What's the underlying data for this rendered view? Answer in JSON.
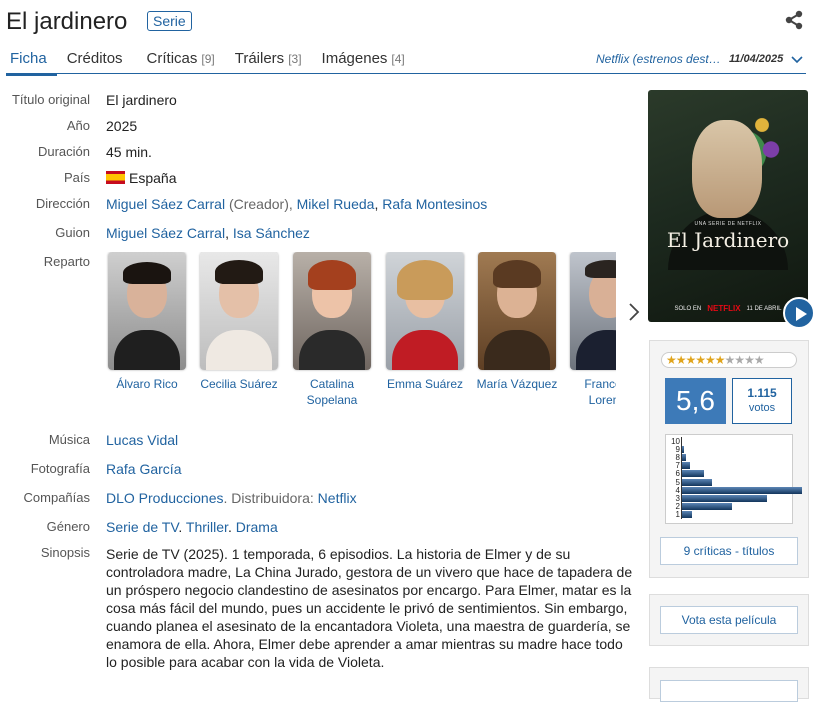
{
  "header": {
    "title": "El jardinero",
    "type_badge": "Serie"
  },
  "tabs": [
    {
      "label": "Ficha",
      "count": ""
    },
    {
      "label": "Créditos",
      "count": ""
    },
    {
      "label": "Críticas",
      "count": "[9]"
    },
    {
      "label": "Tráilers",
      "count": "[3]"
    },
    {
      "label": "Imágenes",
      "count": "[4]"
    }
  ],
  "release": {
    "platform": "Netflix (estrenos destacados)",
    "date": "11/04/2025"
  },
  "info": {
    "original_title_label": "Título original",
    "original_title": "El jardinero",
    "year_label": "Año",
    "year": "2025",
    "duration_label": "Duración",
    "duration": "45 min.",
    "country_label": "País",
    "country": "España",
    "direction_label": "Dirección",
    "director_1": "Miguel Sáez Carral",
    "director_1_role": " (Creador), ",
    "director_2": "Mikel Rueda",
    "director_sep": ", ",
    "director_3": "Rafa Montesinos",
    "script_label": "Guion",
    "script_1": "Miguel Sáez Carral",
    "script_sep": ", ",
    "script_2": "Isa Sánchez",
    "cast_label": "Reparto",
    "music_label": "Música",
    "music": "Lucas Vidal",
    "photo_label": "Fotografía",
    "photo": "Rafa García",
    "companies_label": "Compañías",
    "company_1": "DLO Producciones",
    "distributor_text": ". Distribuidora: ",
    "distributor": "Netflix",
    "genre_label": "Género",
    "genre_1": "Serie de TV",
    "genre_2": "Thriller",
    "genre_3": "Drama",
    "synopsis_label": "Sinopsis",
    "synopsis": "Serie de TV (2025). 1 temporada, 6 episodios. La historia de Elmer y de su controladora madre, La China Jurado, gestora de un vivero que hace de tapadera de un próspero negocio clandestino de asesinatos por encargo. Para Elmer, matar es la cosa más fácil del mundo, pues un accidente le privó de sentimientos. Sin embargo, cuando planea el asesinato de la encantadora Violeta, una maestra de guardería, se enamora de ella. Ahora, Elmer debe aprender a amar mientras su madre hace todo lo posible para acabar con la vida de Violeta."
  },
  "cast": [
    {
      "name": "Álvaro Rico"
    },
    {
      "name": "Cecilia Suárez"
    },
    {
      "name": "Catalina Sopelana"
    },
    {
      "name": "Emma Suárez"
    },
    {
      "name": "María Vázquez"
    },
    {
      "name": "Francesc Lorente"
    }
  ],
  "poster": {
    "small_text": "UNA SERIE DE NETFLIX",
    "title": "El Jardinero",
    "bottom_left": "SOLO EN",
    "brand": "NETFLIX",
    "date_text": "11 DE ABRIL"
  },
  "rating": {
    "stars_on": "★★★★★★",
    "stars_off": "★★★★",
    "average": "5,6",
    "votes_count": "1.115",
    "votes_word": "votos",
    "histogram": [
      1,
      2,
      3,
      4,
      5,
      6,
      7,
      8,
      9,
      10
    ],
    "critics_button": "9 críticas - títulos"
  },
  "vote_button": "Vota esta película",
  "colors": {
    "accent": "#2163a0",
    "rating_bg": "#3d7ab8"
  }
}
